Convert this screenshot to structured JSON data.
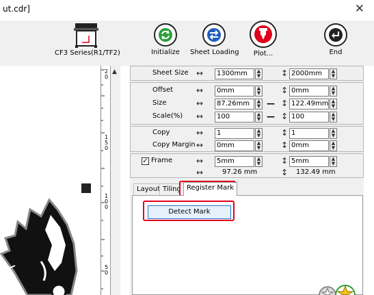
{
  "window": {
    "title": "ut.cdr]",
    "close_glyph": "✕"
  },
  "device": {
    "label": "CF3 Series(R1/TF2)",
    "icon": "plotter-device-icon"
  },
  "toolbar": {
    "buttons": [
      {
        "label": "Initialize",
        "icon": "refresh-icon",
        "color": "#2e9e3a"
      },
      {
        "label": "Sheet Loading",
        "icon": "swap-arrows-icon",
        "color": "#1f5fbf"
      },
      {
        "label": "Plot...",
        "icon": "plot-pen-icon",
        "color": "#e0001b"
      },
      {
        "label": "End",
        "icon": "return-icon",
        "color": "#222222"
      }
    ]
  },
  "ruler": {
    "marks": [
      "2",
      "0",
      "1",
      "5",
      "0",
      "1",
      "0",
      "0",
      "5",
      "0"
    ]
  },
  "settings": {
    "sheet_size": {
      "label": "Sheet Size",
      "width": "1300mm",
      "height": "2000mm"
    },
    "offset": {
      "label": "Offset",
      "x": "0mm",
      "y": "0mm"
    },
    "size": {
      "label": "Size",
      "w": "87.26mm",
      "h": "122.49mm"
    },
    "scale": {
      "label": "Scale(%)",
      "x": "100",
      "y": "100"
    },
    "copy": {
      "label": "Copy",
      "x": "1",
      "y": "1"
    },
    "copy_margin": {
      "label": "Copy Margin",
      "x": "0mm",
      "y": "0mm"
    },
    "frame": {
      "label": "Frame",
      "checked": "✓",
      "x": "5mm",
      "y": "5mm"
    },
    "totals": {
      "width": "97.26 mm",
      "height": "132.49 mm"
    }
  },
  "tabs": [
    {
      "label": "Layout"
    },
    {
      "label": "Tiling"
    },
    {
      "label": "Register Mark"
    }
  ],
  "register_mark": {
    "detect_label": "Detect Mark"
  },
  "accent_red": "#e0001b"
}
